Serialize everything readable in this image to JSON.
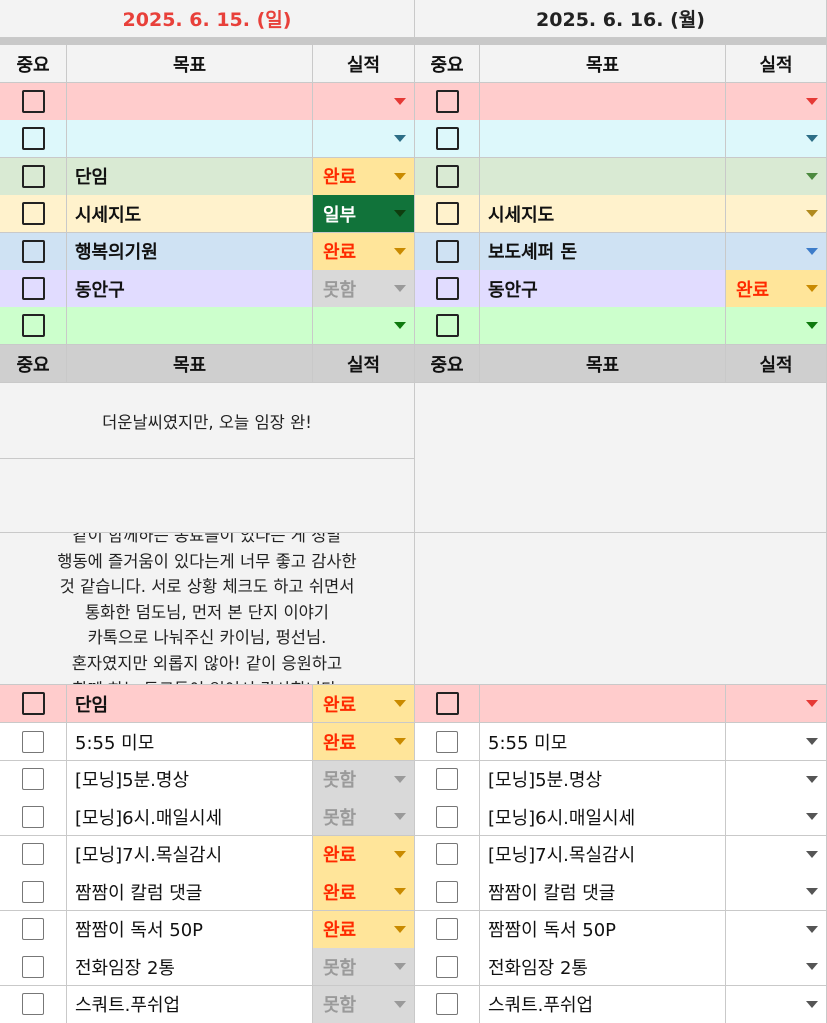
{
  "days": [
    {
      "date": "2025. 6. 15. (일)",
      "color": "#e8403a"
    },
    {
      "date": "2025. 6. 16. (월)",
      "color": "#222222"
    }
  ],
  "headers": {
    "important": "중요",
    "goal": "목표",
    "result": "실적"
  },
  "top_rows": [
    {
      "bg": "#ffcccc",
      "left": {
        "goal": "",
        "status": "",
        "arrow": "#e53935"
      },
      "right": {
        "goal": "",
        "status": "",
        "arrow": "#e53935"
      }
    },
    {
      "bg": "#ddf8fb",
      "left": {
        "goal": "",
        "status": "",
        "arrow": "#2c6e86"
      },
      "right": {
        "goal": "",
        "status": "",
        "arrow": "#2c6e86"
      }
    },
    {
      "bg": "#d9ead3",
      "left": {
        "goal": "단임",
        "status": "완료",
        "arrow": "#c98a00"
      },
      "right": {
        "goal": "",
        "status": "",
        "arrow": "#4c8a3f"
      }
    },
    {
      "bg": "#fff2cc",
      "left": {
        "goal": "시세지도",
        "status": "일부",
        "arrow": "#0f3d0f"
      },
      "right": {
        "goal": "시세지도",
        "status": "",
        "arrow": "#b08a1e"
      }
    },
    {
      "bg": "#cfe2f3",
      "left": {
        "goal": "행복의기원",
        "status": "완료",
        "arrow": "#c98a00"
      },
      "right": {
        "goal": "보도셰퍼 돈",
        "status": "",
        "arrow": "#3d7cc9"
      }
    },
    {
      "bg": "#e1dcff",
      "left": {
        "goal": "동안구",
        "status": "못함",
        "arrow": "#9a9a9a"
      },
      "right": {
        "goal": "동안구",
        "status": "완료",
        "arrow": "#c98a00"
      }
    },
    {
      "bg": "#ccffcc",
      "left": {
        "goal": "",
        "status": "",
        "arrow": "#0e7a0e"
      },
      "right": {
        "goal": "",
        "status": "",
        "arrow": "#0e7a0e"
      }
    }
  ],
  "memo": {
    "short_left": "더운날씨였지만, 오늘 임장 완!",
    "long_left_lines": [
      "같이 함께하는 동료들이 있다는 게 정말",
      "행동에 즐거움이 있다는게 너무 좋고 감사한",
      "것 같습니다. 서로 상황 체크도 하고 쉬면서",
      "통화한 덤도님, 먼저 본 단지 이야기",
      "카톡으로 나눠주신 카이님, 펑선님.",
      "혼자였지만 외롭지 않아! 같이 응원하고",
      "함께 하는 동료들이 있어서 감사합니다."
    ]
  },
  "bottom_pink": {
    "left": {
      "goal": "단임",
      "status": "완료"
    },
    "right": {
      "goal": "",
      "status": ""
    }
  },
  "routine_rows": [
    {
      "left": {
        "goal": "5:55 미모",
        "status": "완료"
      },
      "right": {
        "goal": "5:55 미모",
        "status": ""
      }
    },
    {
      "left": {
        "goal": "[모닝]5분.명상",
        "status": "못함"
      },
      "right": {
        "goal": "[모닝]5분.명상",
        "status": ""
      }
    },
    {
      "left": {
        "goal": "[모닝]6시.매일시세",
        "status": "못함"
      },
      "right": {
        "goal": "[모닝]6시.매일시세",
        "status": ""
      }
    },
    {
      "left": {
        "goal": "[모닝]7시.목실감시",
        "status": "완료"
      },
      "right": {
        "goal": "[모닝]7시.목실감시",
        "status": ""
      }
    },
    {
      "left": {
        "goal": "짬짬이 칼럼 댓글",
        "status": "완료"
      },
      "right": {
        "goal": "짬짬이 칼럼 댓글",
        "status": ""
      }
    },
    {
      "left": {
        "goal": "짬짬이 독서 50P",
        "status": "완료"
      },
      "right": {
        "goal": "짬짬이 독서 50P",
        "status": ""
      }
    },
    {
      "left": {
        "goal": "전화임장 2통",
        "status": "못함"
      },
      "right": {
        "goal": "전화임장 2통",
        "status": ""
      }
    },
    {
      "left": {
        "goal": "스쿼트.푸쉬업",
        "status": "못함"
      },
      "right": {
        "goal": "스쿼트.푸쉬업",
        "status": ""
      }
    }
  ],
  "status_styles": {
    "완료": {
      "bg": "#ffe59a",
      "fg": "#ff2a00",
      "arrow": "#c98a00"
    },
    "일부": {
      "bg": "#11733a",
      "fg": "#ffffff",
      "arrow": "#0f3d0f"
    },
    "못함": {
      "bg": "#d9d9d9",
      "fg": "#9a9a9a",
      "arrow": "#9a9a9a"
    }
  }
}
